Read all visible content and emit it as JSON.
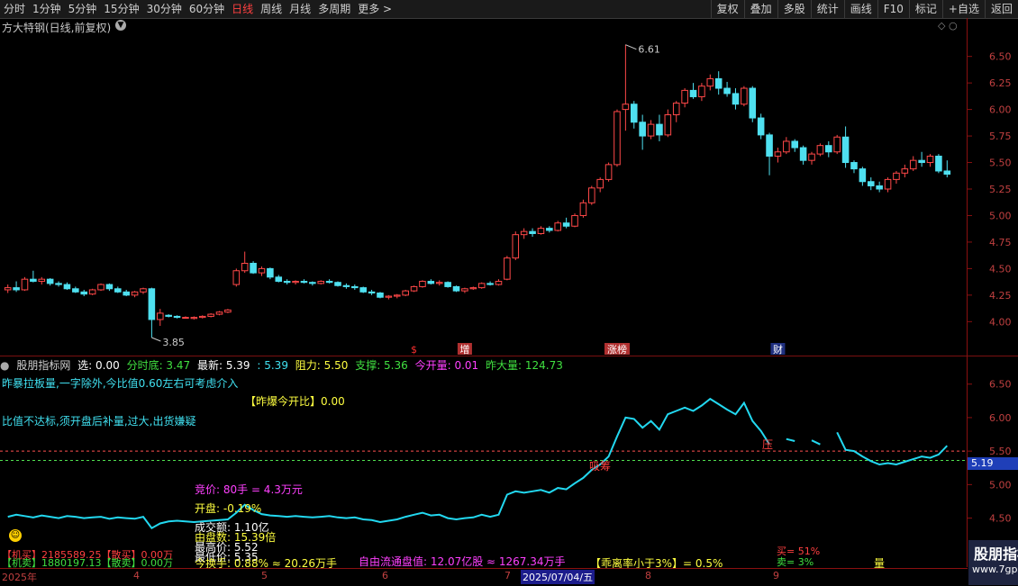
{
  "toolbar": {
    "periods": [
      "分时",
      "1分钟",
      "5分钟",
      "15分钟",
      "30分钟",
      "60分钟",
      "日线",
      "周线",
      "月线",
      "多周期",
      "更多 >"
    ],
    "active_period": "日线",
    "buttons": [
      "复权",
      "叠加",
      "多股",
      "统计",
      "画线",
      "F10",
      "标记",
      "+自选",
      "返回"
    ]
  },
  "stock": {
    "title": "方大特钢(日线,前复权)",
    "high_label": "6.61",
    "low_label": "3.85"
  },
  "main_axis": [
    "6.50",
    "6.25",
    "6.00",
    "5.75",
    "5.50",
    "5.25",
    "5.00",
    "4.75",
    "4.50",
    "4.25",
    "4.00"
  ],
  "event_markers": [
    {
      "text": "$",
      "color": "#ff3030"
    },
    {
      "text": "增",
      "color": "#ffffff",
      "bg": "#b03030"
    },
    {
      "text": "涨榜",
      "color": "#ffffff",
      "bg": "#b03030"
    },
    {
      "text": "财",
      "color": "#ffffff",
      "bg": "#203080"
    }
  ],
  "indicator_bar": {
    "name": "股朋指标网",
    "xuan": "选: 0.00",
    "fenshidi": "分时底: 3.47",
    "zuixin": "最新: 5.39",
    "zuixin2": ": 5.39",
    "zuli": "阻力: 5.50",
    "zhicheng": "支撑: 5.36",
    "jinkailiang": "今开量: 0.01",
    "zuodaliang": "昨大量: 124.73"
  },
  "sub_text": {
    "line1": "昨暴拉板量,一字除外,今比值0.60左右可考虑介入",
    "line2": "【昨爆今开比】0.00",
    "line3": "比值不达标,须开盘后补量,过大,出货嫌疑",
    "jingjia": "竞价: 80手 = 4.3万元",
    "kaipan": "开盘: -0.19%",
    "chengjiao": "成交额: 1.10亿",
    "ziyou": "由盘数: 15.39倍",
    "zuidijia": "最高价: 5.52",
    "zuidi2": "最低价: 5.35",
    "jigou_buy": "【机买】2185589.25【散买】0.00万",
    "jigou_sell": "【机卖】1880197.13【散卖】0.00万",
    "huanshou": "今换手: 0.88% ≈ 20.26万手",
    "ziyouliutong": "自由流通盘值: 12.07亿股 ≈ 1267.34万手",
    "guailv": "【乖离率小于3%】= 0.5%",
    "ya_label": "压",
    "xima_label": "吸筹",
    "mai_pct": "买= 51%",
    "mai2": "卖= 3%",
    "liang": "量"
  },
  "sub_axis": [
    "6.50",
    "6.00",
    "5.50",
    "5.00",
    "4.50"
  ],
  "price_tag": "5.19",
  "dates": [
    {
      "text": "2025年",
      "sel": false
    },
    {
      "text": "4",
      "sel": false
    },
    {
      "text": "5",
      "sel": false
    },
    {
      "text": "6",
      "sel": false
    },
    {
      "text": "7",
      "sel": false
    },
    {
      "text": "2025/07/04/五",
      "sel": true
    },
    {
      "text": "8",
      "sel": false
    },
    {
      "text": "9",
      "sel": false
    }
  ],
  "watermark": {
    "logo": "股朋指标网",
    "url": "www.7gpzb.com"
  },
  "colors": {
    "up": "#ff4848",
    "down": "#4fe0f0",
    "line": "#22d8f0",
    "bg": "#000000"
  },
  "chart_data": {
    "type": "candlestick",
    "ylim": [
      3.85,
      6.65
    ],
    "candles": [
      [
        4.3,
        4.35,
        4.27,
        4.32
      ],
      [
        4.32,
        4.38,
        4.28,
        4.3
      ],
      [
        4.3,
        4.42,
        4.29,
        4.4
      ],
      [
        4.4,
        4.48,
        4.37,
        4.38
      ],
      [
        4.38,
        4.42,
        4.35,
        4.4
      ],
      [
        4.4,
        4.41,
        4.34,
        4.36
      ],
      [
        4.36,
        4.38,
        4.33,
        4.35
      ],
      [
        4.35,
        4.37,
        4.3,
        4.31
      ],
      [
        4.31,
        4.33,
        4.27,
        4.28
      ],
      [
        4.28,
        4.3,
        4.24,
        4.26
      ],
      [
        4.26,
        4.31,
        4.25,
        4.3
      ],
      [
        4.3,
        4.36,
        4.29,
        4.35
      ],
      [
        4.35,
        4.36,
        4.29,
        4.31
      ],
      [
        4.31,
        4.33,
        4.27,
        4.28
      ],
      [
        4.28,
        4.3,
        4.24,
        4.25
      ],
      [
        4.25,
        4.29,
        4.23,
        4.28
      ],
      [
        4.28,
        4.32,
        4.26,
        4.31
      ],
      [
        4.31,
        4.32,
        3.85,
        4.02
      ],
      [
        4.02,
        4.12,
        3.96,
        4.08
      ],
      [
        4.06,
        4.07,
        4.04,
        4.05
      ],
      [
        4.05,
        4.06,
        4.03,
        4.04
      ],
      [
        4.04,
        4.05,
        4.03,
        4.04
      ],
      [
        4.03,
        4.05,
        4.02,
        4.04
      ],
      [
        4.04,
        4.06,
        4.03,
        4.05
      ],
      [
        4.05,
        4.08,
        4.04,
        4.07
      ],
      [
        4.07,
        4.1,
        4.06,
        4.09
      ],
      [
        4.09,
        4.12,
        4.08,
        4.11
      ],
      [
        4.35,
        4.5,
        4.33,
        4.48
      ],
      [
        4.48,
        4.66,
        4.46,
        4.55
      ],
      [
        4.55,
        4.57,
        4.45,
        4.46
      ],
      [
        4.46,
        4.52,
        4.43,
        4.5
      ],
      [
        4.5,
        4.51,
        4.4,
        4.42
      ],
      [
        4.42,
        4.44,
        4.37,
        4.38
      ],
      [
        4.38,
        4.4,
        4.35,
        4.37
      ],
      [
        4.37,
        4.39,
        4.35,
        4.38
      ],
      [
        4.38,
        4.4,
        4.36,
        4.37
      ],
      [
        4.37,
        4.38,
        4.34,
        4.36
      ],
      [
        4.36,
        4.39,
        4.35,
        4.38
      ],
      [
        4.38,
        4.4,
        4.36,
        4.37
      ],
      [
        4.37,
        4.38,
        4.33,
        4.34
      ],
      [
        4.34,
        4.36,
        4.31,
        4.33
      ],
      [
        4.33,
        4.35,
        4.3,
        4.32
      ],
      [
        4.32,
        4.33,
        4.27,
        4.28
      ],
      [
        4.28,
        4.3,
        4.25,
        4.27
      ],
      [
        4.27,
        4.28,
        4.22,
        4.23
      ],
      [
        4.23,
        4.25,
        4.21,
        4.24
      ],
      [
        4.24,
        4.26,
        4.22,
        4.25
      ],
      [
        4.25,
        4.3,
        4.24,
        4.29
      ],
      [
        4.29,
        4.34,
        4.28,
        4.33
      ],
      [
        4.33,
        4.39,
        4.32,
        4.38
      ],
      [
        4.38,
        4.4,
        4.35,
        4.36
      ],
      [
        4.36,
        4.39,
        4.34,
        4.37
      ],
      [
        4.37,
        4.38,
        4.32,
        4.33
      ],
      [
        4.33,
        4.34,
        4.28,
        4.29
      ],
      [
        4.29,
        4.32,
        4.27,
        4.31
      ],
      [
        4.31,
        4.33,
        4.3,
        4.32
      ],
      [
        4.32,
        4.37,
        4.31,
        4.36
      ],
      [
        4.36,
        4.38,
        4.34,
        4.35
      ],
      [
        4.35,
        4.4,
        4.34,
        4.38
      ],
      [
        4.4,
        4.62,
        4.39,
        4.6
      ],
      [
        4.6,
        4.85,
        4.58,
        4.82
      ],
      [
        4.82,
        4.88,
        4.78,
        4.85
      ],
      [
        4.85,
        4.88,
        4.8,
        4.83
      ],
      [
        4.83,
        4.9,
        4.82,
        4.88
      ],
      [
        4.88,
        4.9,
        4.84,
        4.86
      ],
      [
        4.86,
        4.95,
        4.85,
        4.93
      ],
      [
        4.93,
        4.98,
        4.88,
        4.9
      ],
      [
        4.9,
        5.02,
        4.89,
        5.0
      ],
      [
        5.0,
        5.15,
        4.98,
        5.12
      ],
      [
        5.12,
        5.28,
        5.1,
        5.26
      ],
      [
        5.26,
        5.36,
        5.22,
        5.34
      ],
      [
        5.34,
        5.5,
        5.32,
        5.48
      ],
      [
        5.48,
        6.0,
        5.46,
        5.98
      ],
      [
        6.0,
        6.61,
        5.8,
        6.05
      ],
      [
        6.05,
        6.08,
        5.82,
        5.88
      ],
      [
        5.88,
        5.95,
        5.62,
        5.75
      ],
      [
        5.75,
        5.9,
        5.72,
        5.86
      ],
      [
        5.86,
        5.95,
        5.7,
        5.76
      ],
      [
        5.76,
        6.0,
        5.74,
        5.95
      ],
      [
        5.95,
        6.08,
        5.88,
        6.06
      ],
      [
        6.06,
        6.2,
        6.02,
        6.18
      ],
      [
        6.18,
        6.25,
        6.1,
        6.12
      ],
      [
        6.12,
        6.25,
        6.08,
        6.22
      ],
      [
        6.22,
        6.33,
        6.18,
        6.29
      ],
      [
        6.29,
        6.36,
        6.14,
        6.2
      ],
      [
        6.2,
        6.26,
        6.12,
        6.15
      ],
      [
        6.15,
        6.2,
        6.0,
        6.05
      ],
      [
        6.05,
        6.22,
        6.03,
        6.2
      ],
      [
        6.2,
        6.22,
        5.88,
        5.92
      ],
      [
        5.92,
        5.96,
        5.72,
        5.76
      ],
      [
        5.76,
        5.78,
        5.38,
        5.56
      ],
      [
        5.56,
        5.64,
        5.5,
        5.6
      ],
      [
        5.6,
        5.74,
        5.58,
        5.7
      ],
      [
        5.7,
        5.72,
        5.6,
        5.64
      ],
      [
        5.64,
        5.66,
        5.48,
        5.52
      ],
      [
        5.52,
        5.6,
        5.48,
        5.58
      ],
      [
        5.58,
        5.68,
        5.56,
        5.66
      ],
      [
        5.66,
        5.7,
        5.55,
        5.6
      ],
      [
        5.6,
        5.76,
        5.58,
        5.74
      ],
      [
        5.74,
        5.84,
        5.45,
        5.5
      ],
      [
        5.5,
        5.52,
        5.4,
        5.44
      ],
      [
        5.44,
        5.46,
        5.28,
        5.32
      ],
      [
        5.32,
        5.36,
        5.24,
        5.28
      ],
      [
        5.28,
        5.32,
        5.22,
        5.25
      ],
      [
        5.25,
        5.36,
        5.22,
        5.34
      ],
      [
        5.34,
        5.42,
        5.3,
        5.4
      ],
      [
        5.4,
        5.48,
        5.36,
        5.44
      ],
      [
        5.44,
        5.56,
        5.42,
        5.52
      ],
      [
        5.52,
        5.6,
        5.46,
        5.5
      ],
      [
        5.5,
        5.58,
        5.46,
        5.56
      ],
      [
        5.56,
        5.58,
        5.4,
        5.42
      ],
      [
        5.42,
        5.52,
        5.36,
        5.39
      ]
    ],
    "sub_line": [
      4.52,
      4.55,
      4.53,
      4.51,
      4.54,
      4.52,
      4.5,
      4.53,
      4.52,
      4.5,
      4.51,
      4.52,
      4.49,
      4.51,
      4.5,
      4.49,
      4.52,
      4.35,
      4.42,
      4.45,
      4.46,
      4.45,
      4.44,
      4.45,
      4.46,
      4.47,
      4.48,
      4.58,
      4.7,
      4.62,
      4.56,
      4.54,
      4.53,
      4.52,
      4.53,
      4.52,
      4.51,
      4.52,
      4.53,
      4.51,
      4.5,
      4.51,
      4.48,
      4.47,
      4.44,
      4.46,
      4.48,
      4.52,
      4.55,
      4.58,
      4.54,
      4.55,
      4.5,
      4.48,
      4.5,
      4.51,
      4.55,
      4.52,
      4.55,
      4.85,
      4.9,
      4.88,
      4.9,
      4.92,
      4.88,
      4.95,
      4.93,
      5.02,
      5.1,
      5.22,
      5.3,
      5.42,
      5.72,
      6.0,
      5.98,
      5.85,
      5.95,
      5.82,
      6.05,
      6.1,
      6.15,
      6.1,
      6.18,
      6.28,
      6.2,
      6.12,
      6.05,
      6.22,
      5.95,
      5.8,
      5.6,
      null,
      5.68,
      5.65,
      null,
      5.66,
      5.6,
      null,
      5.78,
      5.52,
      5.5,
      5.42,
      5.35,
      5.3,
      5.32,
      5.3,
      5.34,
      5.38,
      5.42,
      5.4,
      5.45,
      5.58
    ]
  }
}
